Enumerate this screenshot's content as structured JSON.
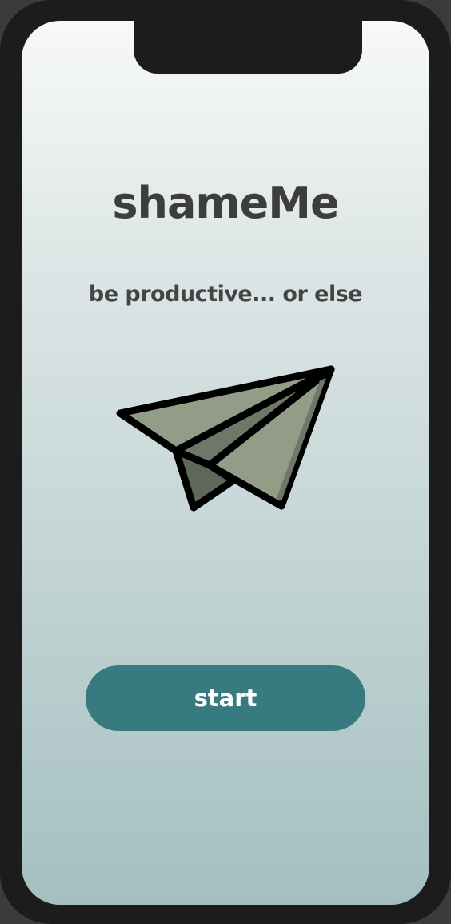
{
  "app": {
    "title": "shameMe",
    "tagline": "be productive... or else"
  },
  "illustration": {
    "icon": "paper-plane-icon",
    "fill_colors": [
      "#939c87",
      "#6f7768",
      "#5f6759"
    ],
    "stroke_color": "#000000"
  },
  "actions": {
    "start_label": "start"
  },
  "colors": {
    "background_top": "#f8f9f9",
    "background_bottom": "#a5bfc0",
    "title_text": "#3d3d3d",
    "accent": "#377b81"
  }
}
